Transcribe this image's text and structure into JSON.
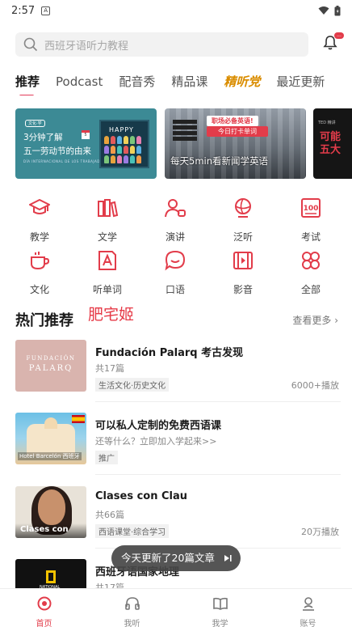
{
  "status_bar": {
    "time": "2:57"
  },
  "search": {
    "placeholder": "西班牙语听力教程",
    "badge": "..."
  },
  "tabs": [
    {
      "label": "推荐",
      "active": true
    },
    {
      "label": "Podcast"
    },
    {
      "label": "配音秀"
    },
    {
      "label": "精品课"
    },
    {
      "label": "精听党"
    },
    {
      "label": "最近更新"
    }
  ],
  "banners": {
    "b1": {
      "tag": "文化·学",
      "line1": "3分钟了解",
      "line2": "五一劳动节的由来",
      "calendar": "5",
      "footer": "DÍA INTERNACIONAL DE LOS TRABAJADORES",
      "poster": "HAPPY"
    },
    "b2": {
      "pill1": "职场必备英语!",
      "pill2": "今日打卡单词",
      "caption": "每天5min看新闻学英语"
    },
    "b3": {
      "text": "可能",
      "text2": "五大",
      "tiny": "TED 精讲"
    }
  },
  "categories": [
    {
      "label": "教学",
      "icon": "graduation-cap-icon"
    },
    {
      "label": "文学",
      "icon": "books-icon"
    },
    {
      "label": "演讲",
      "icon": "speaker-icon"
    },
    {
      "label": "泛听",
      "icon": "globe-icon"
    },
    {
      "label": "考试",
      "icon": "exam-100-icon"
    },
    {
      "label": "文化",
      "icon": "cup-icon"
    },
    {
      "label": "听单词",
      "icon": "word-card-icon"
    },
    {
      "label": "口语",
      "icon": "speech-bubble-icon"
    },
    {
      "label": "影音",
      "icon": "film-icon"
    },
    {
      "label": "全部",
      "icon": "grid-flower-icon"
    }
  ],
  "section": {
    "title": "热门推荐",
    "stamp": "肥宅姬",
    "more": "查看更多"
  },
  "items": [
    {
      "title": "Fundación Palarq 考古发现",
      "sub": "共17篇",
      "tag": "生活文化·历史文化",
      "plays": "6000+播放",
      "thumb_text1": "FUNDACIÓN",
      "thumb_text2": "PALARQ"
    },
    {
      "title": "可以私人定制的免费西语课",
      "sub": "还等什么？立即加入学起来>>",
      "tag": "推广",
      "plays": "",
      "thumb_text1": "Hotel Barcelón 西班牙"
    },
    {
      "title": "Clases con Clau",
      "sub": "共66篇",
      "tag": "西语课堂·综合学习",
      "plays": "20万播放",
      "thumb_text1": "Clases con Clau"
    },
    {
      "title": "西班牙语国家地理",
      "sub": "共17篇",
      "tag": "",
      "plays": "",
      "thumb_text1": "NATIONAL"
    }
  ],
  "toast": {
    "text": "今天更新了20篇文章"
  },
  "bottom_nav": [
    {
      "label": "首页",
      "active": true
    },
    {
      "label": "我听"
    },
    {
      "label": "我学"
    },
    {
      "label": "账号"
    }
  ],
  "colors": {
    "accent": "#e23c4a",
    "banner1": "#3c8a95"
  }
}
